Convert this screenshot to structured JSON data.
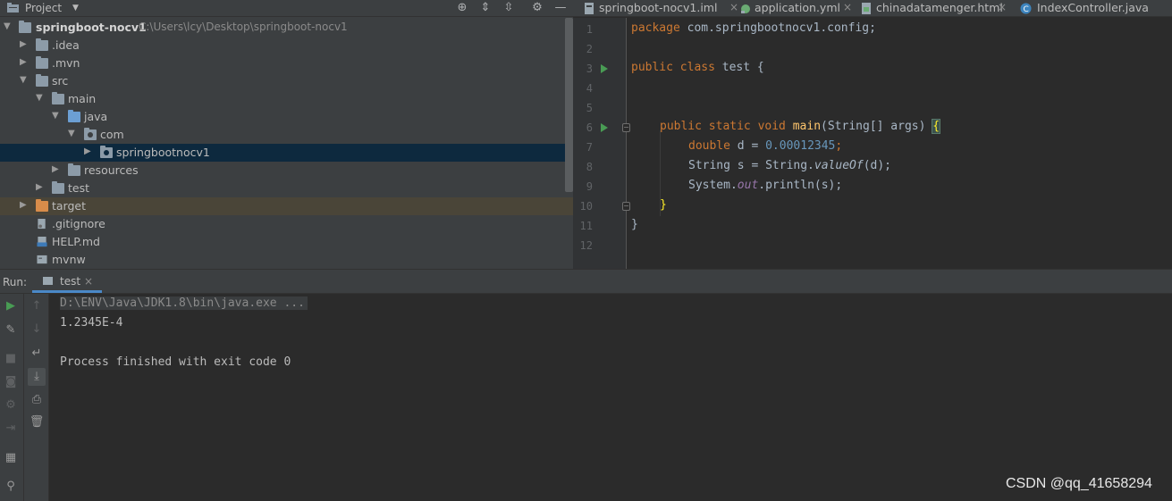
{
  "project": {
    "title": "Project",
    "tree": [
      {
        "label": "springboot-nocv1",
        "path": "C:\\Users\\lcy\\Desktop\\springboot-nocv1"
      },
      {
        "label": ".idea"
      },
      {
        "label": ".mvn"
      },
      {
        "label": "src"
      },
      {
        "label": "main"
      },
      {
        "label": "java"
      },
      {
        "label": "com"
      },
      {
        "label": "springbootnocv1"
      },
      {
        "label": "resources"
      },
      {
        "label": "test"
      },
      {
        "label": "target"
      },
      {
        "label": ".gitignore"
      },
      {
        "label": "HELP.md"
      },
      {
        "label": "mvnw"
      }
    ]
  },
  "tabs": [
    {
      "label": "springboot-nocv1.iml"
    },
    {
      "label": "application.yml"
    },
    {
      "label": "chinadatamenger.html"
    },
    {
      "label": "IndexController.java"
    }
  ],
  "editor": {
    "line_numbers": [
      "1",
      "2",
      "3",
      "4",
      "5",
      "6",
      "7",
      "8",
      "9",
      "10",
      "11",
      "12"
    ],
    "code": {
      "l1_kw": "package",
      "l1_rest": " com.springbootnocv1.config;",
      "l3_kw1": "public",
      "l3_kw2": "class",
      "l3_rest": " test {",
      "l6_kw": "public static void",
      "l6_fn": "main",
      "l6_rest": "(String[] args) ",
      "l6_brace": "{",
      "l7_kw": "double",
      "l7_mid": " d = ",
      "l7_num": "0.00012345",
      "l7_end": ";",
      "l8_a": "String s = String.",
      "l8_it": "valueOf",
      "l8_b": "(d);",
      "l9_a": "System.",
      "l9_fld": "out",
      "l9_b": ".println(s);",
      "l10": "}",
      "l11": "}"
    }
  },
  "run": {
    "label": "Run:",
    "tab_label": "test",
    "console": {
      "command": "D:\\ENV\\Java\\JDK1.8\\bin\\java.exe ...",
      "output": "1.2345E-4",
      "exit": "Process finished with exit code 0"
    }
  },
  "watermark": "CSDN @qq_41658294"
}
